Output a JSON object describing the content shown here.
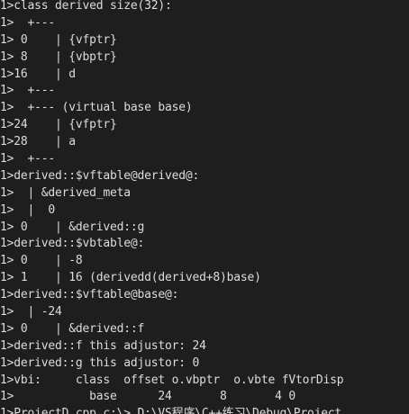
{
  "output": {
    "lines": [
      "1>class derived size(32):",
      "1>  +---",
      "1> 0    | {vfptr}",
      "1> 8    | {vbptr}",
      "1>16    | d",
      "1>  +---",
      "1>  +--- (virtual base base)",
      "1>24    | {vfptr}",
      "1>28    | a",
      "1>  +---",
      "1>derived::$vftable@derived@:",
      "1>  | &derived_meta",
      "1>  |  0",
      "1> 0    | &derived::g",
      "1>derived::$vbtable@:",
      "1> 0    | -8",
      "1> 1    | 16 (derivedd(derived+8)base)",
      "1>derived::$vftable@base@:",
      "1>  | -24",
      "1> 0    | &derived::f",
      "1>derived::f this adjustor: 24",
      "1>derived::g this adjustor: 0",
      "1>vbi:     class  offset o.vbptr  o.vbte fVtorDisp",
      "1>           base      24       8       4 0",
      "1>ProjectD.cpp.c:\\> D:\\VS程序\\C++练习\\Debug\\Project"
    ]
  }
}
